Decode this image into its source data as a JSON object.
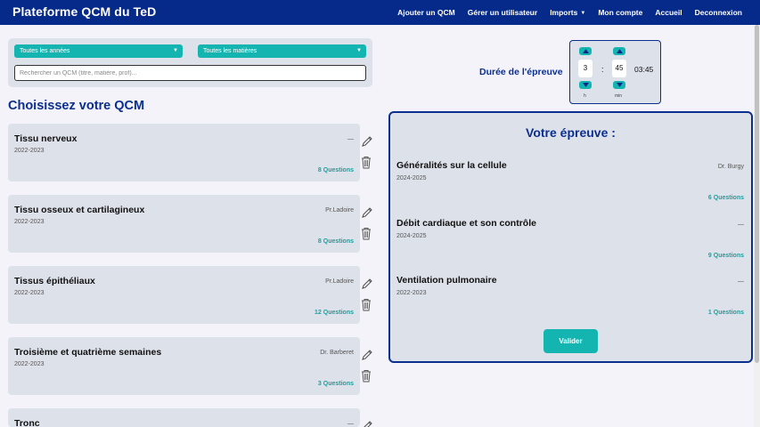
{
  "navbar": {
    "brand": "Plateforme QCM du TeD",
    "links": [
      "Ajouter un QCM",
      "Gérer un utilisateur",
      "Imports",
      "Mon compte",
      "Accueil",
      "Deconnexion"
    ]
  },
  "filters": {
    "year_select": "Toutes les années",
    "subject_select": "Toutes les matières",
    "search_placeholder": "Rechercher un QCM (titre, matière, prof)..."
  },
  "section_title": "Choisissez votre QCM",
  "qcm_list": [
    {
      "name": "Tissu nerveux",
      "year": "2022-2023",
      "prof": "—",
      "count": "8 Questions"
    },
    {
      "name": "Tissu osseux et cartilagineux",
      "year": "2022-2023",
      "prof": "Pr.Ladoire",
      "count": "8 Questions"
    },
    {
      "name": "Tissus épithéliaux",
      "year": "2022-2023",
      "prof": "Pr.Ladoire",
      "count": "12 Questions"
    },
    {
      "name": "Troisième et quatrième semaines",
      "year": "2022-2023",
      "prof": "Dr. Barberet",
      "count": "3 Questions"
    },
    {
      "name": "Tronc",
      "year": "",
      "prof": "—",
      "count": ""
    }
  ],
  "duration": {
    "label": "Durée de l'épreuve",
    "hours": "3",
    "minutes": "45",
    "hours_unit": "h",
    "minutes_unit": "min",
    "separator": ":",
    "total": "03:45"
  },
  "epreuve": {
    "title": "Votre épreuve :",
    "items": [
      {
        "name": "Généralités sur la cellule",
        "year": "2024-2025",
        "prof": "Dr. Burgy",
        "count": "6 Questions"
      },
      {
        "name": "Débit cardiaque et son contrôle",
        "year": "2024-2025",
        "prof": "—",
        "count": "9 Questions"
      },
      {
        "name": "Ventilation pulmonaire",
        "year": "2022-2023",
        "prof": "—",
        "count": "1 Questions"
      }
    ],
    "validate_label": "Valider"
  },
  "colors": {
    "navy": "#062a8a",
    "teal": "#14b5b0",
    "card": "#dde1e9",
    "accent_text": "#17a2a2"
  }
}
